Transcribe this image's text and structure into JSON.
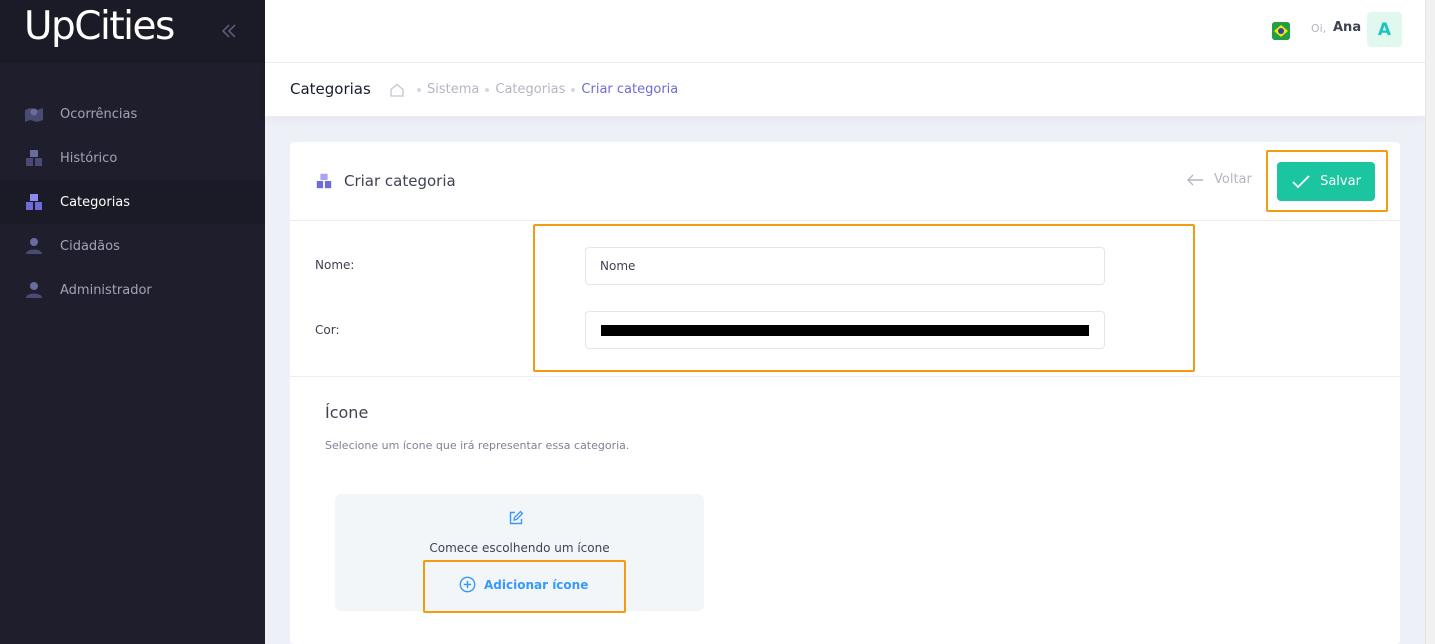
{
  "brand": {
    "logo_text": "UpCities"
  },
  "sidebar": {
    "items": [
      {
        "label": "Ocorrências",
        "icon": "map-marker-icon",
        "active": false
      },
      {
        "label": "Histórico",
        "icon": "boxes-icon",
        "active": false
      },
      {
        "label": "Categorias",
        "icon": "boxes-icon",
        "active": true
      },
      {
        "label": "Cidadãos",
        "icon": "user-icon",
        "active": false
      },
      {
        "label": "Administrador",
        "icon": "user-icon",
        "active": false
      }
    ]
  },
  "header": {
    "greeting": "Oi,",
    "user_name": "Ana",
    "avatar_letter": "A",
    "language_flag": "brazil-flag-icon"
  },
  "subheader": {
    "title": "Categorias",
    "breadcrumbs": [
      "Sistema",
      "Categorias",
      "Criar categoria"
    ]
  },
  "card": {
    "title": "Criar categoria",
    "back_label": "Voltar",
    "save_label": "Salvar"
  },
  "form": {
    "name_label": "Nome:",
    "name_placeholder": "Nome",
    "name_value": "",
    "color_label": "Cor:",
    "color_value": "#000000"
  },
  "icon_section": {
    "title": "Ícone",
    "description": "Selecione um ícone que irá representar essa categoria.",
    "empty_text": "Comece escolhendo um ícone",
    "add_label": "Adicionar ícone"
  },
  "colors": {
    "sidebar_bg": "#1e1e2d",
    "accent": "#6e6bd6",
    "success": "#1bc5a0",
    "highlight": "#f39c12",
    "link": "#3699ff"
  }
}
